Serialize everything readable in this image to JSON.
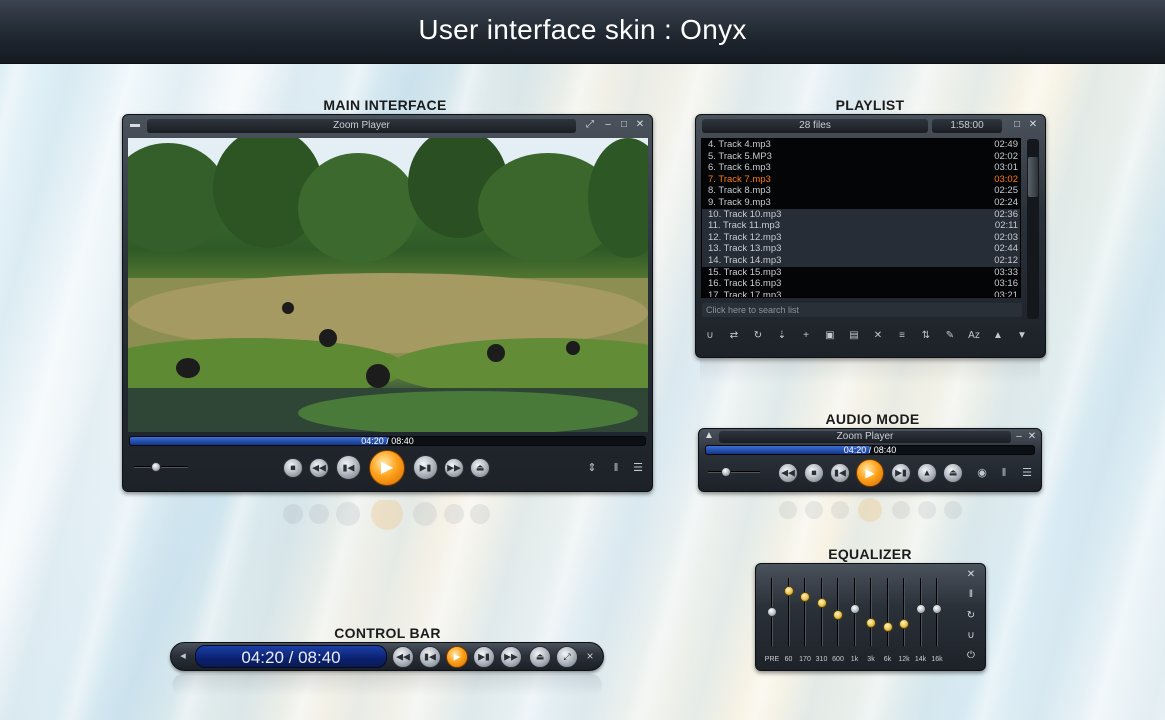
{
  "banner": {
    "title": "User interface skin : Onyx"
  },
  "sections": {
    "main_interface": "MAIN INTERFACE",
    "playlist": "PLAYLIST",
    "audio_mode": "AUDIO MODE",
    "equalizer": "EQUALIZER",
    "control_bar": "CONTROL BAR"
  },
  "main_window": {
    "title": "Zoom Player",
    "time": "04:20 / 08:40",
    "progress_fraction": 0.5,
    "volume_fraction": 0.4,
    "icons": [
      "stop-icon",
      "rewind-icon",
      "skip-back-icon",
      "play-icon",
      "skip-forward-icon",
      "fast-forward-icon",
      "open-icon"
    ]
  },
  "playlist": {
    "file_count": "28 files",
    "total_time": "1:58:00",
    "search_placeholder": "Click here to search list",
    "tracks": [
      {
        "name": "4. Track 4.mp3",
        "duration": "02:49",
        "current": false
      },
      {
        "name": "5. Track 5.MP3",
        "duration": "02:02",
        "current": false
      },
      {
        "name": "6. Track 6.mp3",
        "duration": "03:01",
        "current": false
      },
      {
        "name": "7. Track 7.mp3",
        "duration": "03:02",
        "current": true
      },
      {
        "name": "8. Track 8.mp3",
        "duration": "02:25",
        "current": false
      },
      {
        "name": "9. Track 9.mp3",
        "duration": "02:24",
        "current": false
      },
      {
        "name": "10. Track 10.mp3",
        "duration": "02:36",
        "current": false
      },
      {
        "name": "11. Track 11.mp3",
        "duration": "02:11",
        "current": false
      },
      {
        "name": "12. Track 12.mp3",
        "duration": "02:03",
        "current": false
      },
      {
        "name": "13. Track 13.mp3",
        "duration": "02:44",
        "current": false
      },
      {
        "name": "14. Track 14.mp3",
        "duration": "02:12",
        "current": false
      },
      {
        "name": "15. Track 15.mp3",
        "duration": "03:33",
        "current": false
      },
      {
        "name": "16. Track 16.mp3",
        "duration": "03:16",
        "current": false
      },
      {
        "name": "17. Track 17.mp3",
        "duration": "03:21",
        "current": false
      }
    ],
    "toolbar_icons": [
      "magnet-icon",
      "shuffle-icon",
      "repeat-icon",
      "download-icon",
      "add-file-icon",
      "add-folder-icon",
      "save-list-icon",
      "remove-icon",
      "sort-icon",
      "move-icon",
      "edit-icon",
      "az-sort-icon",
      "move-up-icon",
      "move-down-icon"
    ]
  },
  "audio_mode": {
    "title": "Zoom Player",
    "time": "04:20 / 08:40",
    "progress_fraction": 0.5,
    "volume_fraction": 0.35
  },
  "equalizer": {
    "bands": [
      "PRE",
      "60",
      "170",
      "310",
      "600",
      "1k",
      "3k",
      "6k",
      "12k",
      "14k",
      "16k"
    ],
    "levels": [
      0.0,
      0.35,
      0.25,
      0.15,
      -0.05,
      0.05,
      -0.18,
      -0.25,
      -0.2,
      0.05,
      0.05
    ],
    "gold_bands": [
      1,
      2,
      3,
      4,
      6,
      7,
      8
    ]
  },
  "control_bar": {
    "time": "04:20 / 08:40",
    "close_label": "×"
  },
  "colors": {
    "accent_orange": "#ff9a1a",
    "progress_blue": "#2b5fc4",
    "current_track": "#ff7a12"
  }
}
